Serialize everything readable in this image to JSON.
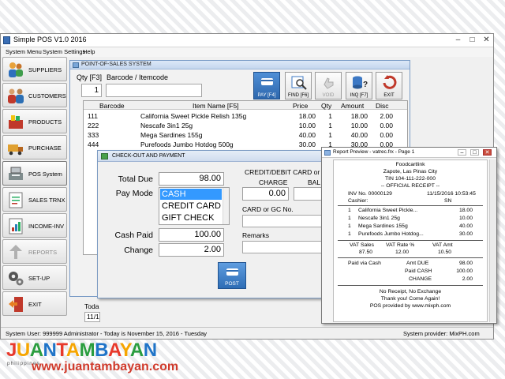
{
  "window": {
    "title": "Simple POS V1.0 2016",
    "min": "–",
    "max": "□",
    "close": "✕"
  },
  "menu": [
    "System Menu",
    "System Settings",
    "Help"
  ],
  "sidebar": {
    "items": [
      {
        "label": "SUPPLIERS",
        "icon": "suppliers-people-icon"
      },
      {
        "label": "CUSTOMERS",
        "icon": "customers-people-icon"
      },
      {
        "label": "PRODUCTS",
        "icon": "products-basket-icon"
      },
      {
        "label": "PURCHASE",
        "icon": "purchase-truck-icon"
      },
      {
        "label": "POS System",
        "icon": "pos-register-icon"
      },
      {
        "label": "SALES TRNX",
        "icon": "sales-report-icon"
      },
      {
        "label": "INCOME-INV",
        "icon": "income-chart-icon"
      },
      {
        "label": "REPORTS",
        "icon": "reports-icon"
      },
      {
        "label": "SET-UP",
        "icon": "setup-gears-icon"
      },
      {
        "label": "EXIT",
        "icon": "exit-door-icon"
      }
    ]
  },
  "pos": {
    "title": "POINT-OF-SALES SYSTEM",
    "qty_label": "Qty [F3]",
    "qty_value": "1",
    "barcode_label": "Barcode / Itemcode",
    "barcode_value": "",
    "toolbar": {
      "pay": "PAY [F4]",
      "find": "FIND [F6]",
      "void": "VOID",
      "inq": "INQ [F7]",
      "exit": "EXIT"
    },
    "columns": [
      "Barcode",
      "Item Name [F5]",
      "Price",
      "Qty",
      "Amount",
      "Disc"
    ],
    "rows": [
      [
        "111",
        "California Sweet Pickle Relish 135g",
        "18.00",
        "1",
        "18.00",
        "2.00"
      ],
      [
        "222",
        "Nescafe 3in1 25g",
        "10.00",
        "1",
        "10.00",
        "0.00"
      ],
      [
        "333",
        "Mega Sardines 155g",
        "40.00",
        "1",
        "40.00",
        "0.00"
      ],
      [
        "444",
        "Purefoods Jumbo Hotdog 500g",
        "30.00",
        "1",
        "30.00",
        "0.00"
      ]
    ],
    "date_label": "Toda",
    "date_value": "11/1"
  },
  "checkout": {
    "title": "CHECK-OUT AND PAYMENT",
    "total_due_label": "Total Due",
    "total_due": "98.00",
    "pay_mode_label": "Pay Mode",
    "pay_modes": [
      "CASH",
      "CREDIT CARD",
      "GIFT CHECK"
    ],
    "cash_paid_label": "Cash Paid",
    "cash_paid": "100.00",
    "change_label": "Change",
    "change": "2.00",
    "card_group_label": "CREDIT/DEBIT CARD or G",
    "charge_label": "CHARGE",
    "charge_value": "0.00",
    "balance_label": "BAL",
    "card_no_label": "CARD or GC No.",
    "remarks_label": "Remarks",
    "post_label": "POST"
  },
  "report": {
    "title": "Report Preview - vatrec.frx - Page 1",
    "store": "Foodcartlink",
    "city": "Zapote, Las Pinas City",
    "tin": "TIN 104-111-222-000",
    "inv": "INV No. 00000129",
    "datetime": "11/15/2016 10:53:45",
    "cashier_label": "Cashier:",
    "cashier_code": "SN",
    "receipt_heading": "-- OFFICIAL RECEIPT --",
    "lines": [
      [
        "1",
        "California Sweet Pickle...",
        "18.00"
      ],
      [
        "1",
        "Nescafe 3in1 25g",
        "10.00"
      ],
      [
        "1",
        "Mega Sardines 155g",
        "40.00"
      ],
      [
        "1",
        "Purefoods Jumbo Hotdog...",
        "30.00"
      ]
    ],
    "vat_headers": [
      "VAT Sales",
      "VAT Rate %",
      "VAT Amt"
    ],
    "vat_values": [
      "87.50",
      "12.00",
      "10.50"
    ],
    "paid_via": "Paid via Cash",
    "amt_due_label": "Amt DUE",
    "amt_due": "98.00",
    "paid_cash_label": "Paid CASH",
    "paid_cash": "100.00",
    "change_label": "CHANGE",
    "change": "2.00",
    "footer": [
      "No Receipt, No Exchange",
      "Thank you! Come Again!",
      "POS provided by www.mixph.com"
    ]
  },
  "status": {
    "left": "System User: 999999 Administrator - Today is November 15, 2016 - Tuesday",
    "right": "System provider: MixPH.com"
  },
  "watermark": {
    "logo": "JUANTAMBAYAN",
    "country": "philippines",
    "url": "www.juantambayan.com",
    "colors": [
      "#e8392c",
      "#f6a500",
      "#2a9d3f",
      "#1f74c8"
    ]
  }
}
